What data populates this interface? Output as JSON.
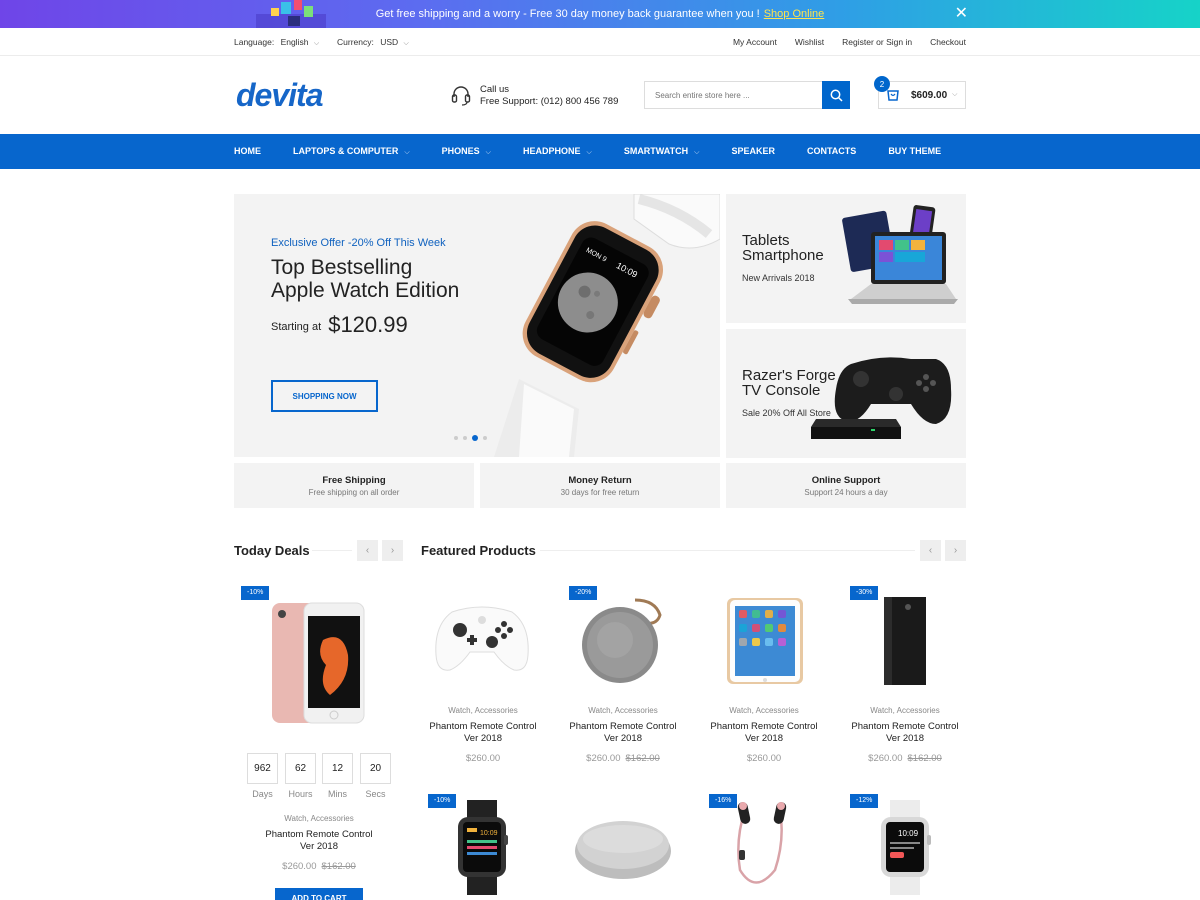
{
  "promo": {
    "text": "Get free shipping and a worry - Free 30 day money back guarantee when you !",
    "link": "Shop Online",
    "close_icon": "close-icon"
  },
  "utility": {
    "language_label": "Language:",
    "language_value": "English",
    "currency_label": "Currency:",
    "currency_value": "USD",
    "links": [
      "My Account",
      "Wishlist",
      "Register or Sign in",
      "Checkout"
    ]
  },
  "header": {
    "logo_text": "devita",
    "call_title": "Call us",
    "call_support": "Free Support: (012) 800 456 789",
    "search_placeholder": "Search entire store here ...",
    "cart_count": "2",
    "cart_total": "$609.00"
  },
  "nav": {
    "items": [
      {
        "label": "HOME",
        "has_dropdown": false
      },
      {
        "label": "LAPTOPS & COMPUTER",
        "has_dropdown": true
      },
      {
        "label": "PHONES",
        "has_dropdown": true
      },
      {
        "label": "HEADPHONE",
        "has_dropdown": true
      },
      {
        "label": "SMARTWATCH",
        "has_dropdown": true
      },
      {
        "label": "SPEAKER",
        "has_dropdown": false
      },
      {
        "label": "CONTACTS",
        "has_dropdown": false
      },
      {
        "label": "BUY THEME",
        "has_dropdown": false
      }
    ]
  },
  "hero": {
    "offer": "Exclusive Offer -20% Off This Week",
    "title_line1": "Top Bestselling",
    "title_line2": "Apple Watch Edition",
    "starting_label": "Starting at",
    "price": "$120.99",
    "button": "SHOPPING NOW",
    "watch_screen_date": "MON 9",
    "watch_screen_time": "10:09",
    "slide_count": 4,
    "active_slide": 3
  },
  "side_banners": [
    {
      "title_line1": "Tablets",
      "title_line2": "Smartphone",
      "subtitle": "New Arrivals 2018"
    },
    {
      "title_line1": "Razer's Forge",
      "title_line2": "TV Console",
      "subtitle": "Sale 20% Off All Store"
    }
  ],
  "features": [
    {
      "title": "Free Shipping",
      "subtitle": "Free shipping on all order"
    },
    {
      "title": "Money Return",
      "subtitle": "30 days for free return"
    },
    {
      "title": "Online Support",
      "subtitle": "Support 24 hours a day"
    }
  ],
  "today_deals": {
    "title": "Today Deals",
    "badge": "-10%",
    "countdown": [
      {
        "value": "962",
        "label": "Days"
      },
      {
        "value": "62",
        "label": "Hours"
      },
      {
        "value": "12",
        "label": "Mins"
      },
      {
        "value": "20",
        "label": "Secs"
      }
    ],
    "category": "Watch, Accessories",
    "name_line1": "Phantom Remote Control",
    "name_line2": "Ver 2018",
    "price": "$260.00",
    "old_price": "$162.00",
    "button": "ADD TO CART"
  },
  "featured": {
    "title": "Featured Products",
    "row1": [
      {
        "badge": "",
        "category": "Watch, Accessories",
        "name_line1": "Phantom Remote Control",
        "name_line2": "Ver 2018",
        "price": "$260.00",
        "old_price": ""
      },
      {
        "badge": "-20%",
        "category": "Watch, Accessories",
        "name_line1": "Phantom Remote Control",
        "name_line2": "Ver 2018",
        "price": "$260.00",
        "old_price": "$162.00"
      },
      {
        "badge": "",
        "category": "Watch, Accessories",
        "name_line1": "Phantom Remote Control",
        "name_line2": "Ver 2018",
        "price": "$260.00",
        "old_price": ""
      },
      {
        "badge": "-30%",
        "category": "Watch, Accessories",
        "name_line1": "Phantom Remote Control",
        "name_line2": "Ver 2018",
        "price": "$260.00",
        "old_price": "$162.00"
      }
    ],
    "row2_badges": [
      "-10%",
      "",
      "-16%",
      "-12%"
    ],
    "row2_watch_time": "10:09"
  },
  "colors": {
    "accent": "#0766cd",
    "promo_gradient_start": "#6f45e8",
    "promo_gradient_end": "#16d3c8",
    "promo_link": "#ffe34d"
  }
}
